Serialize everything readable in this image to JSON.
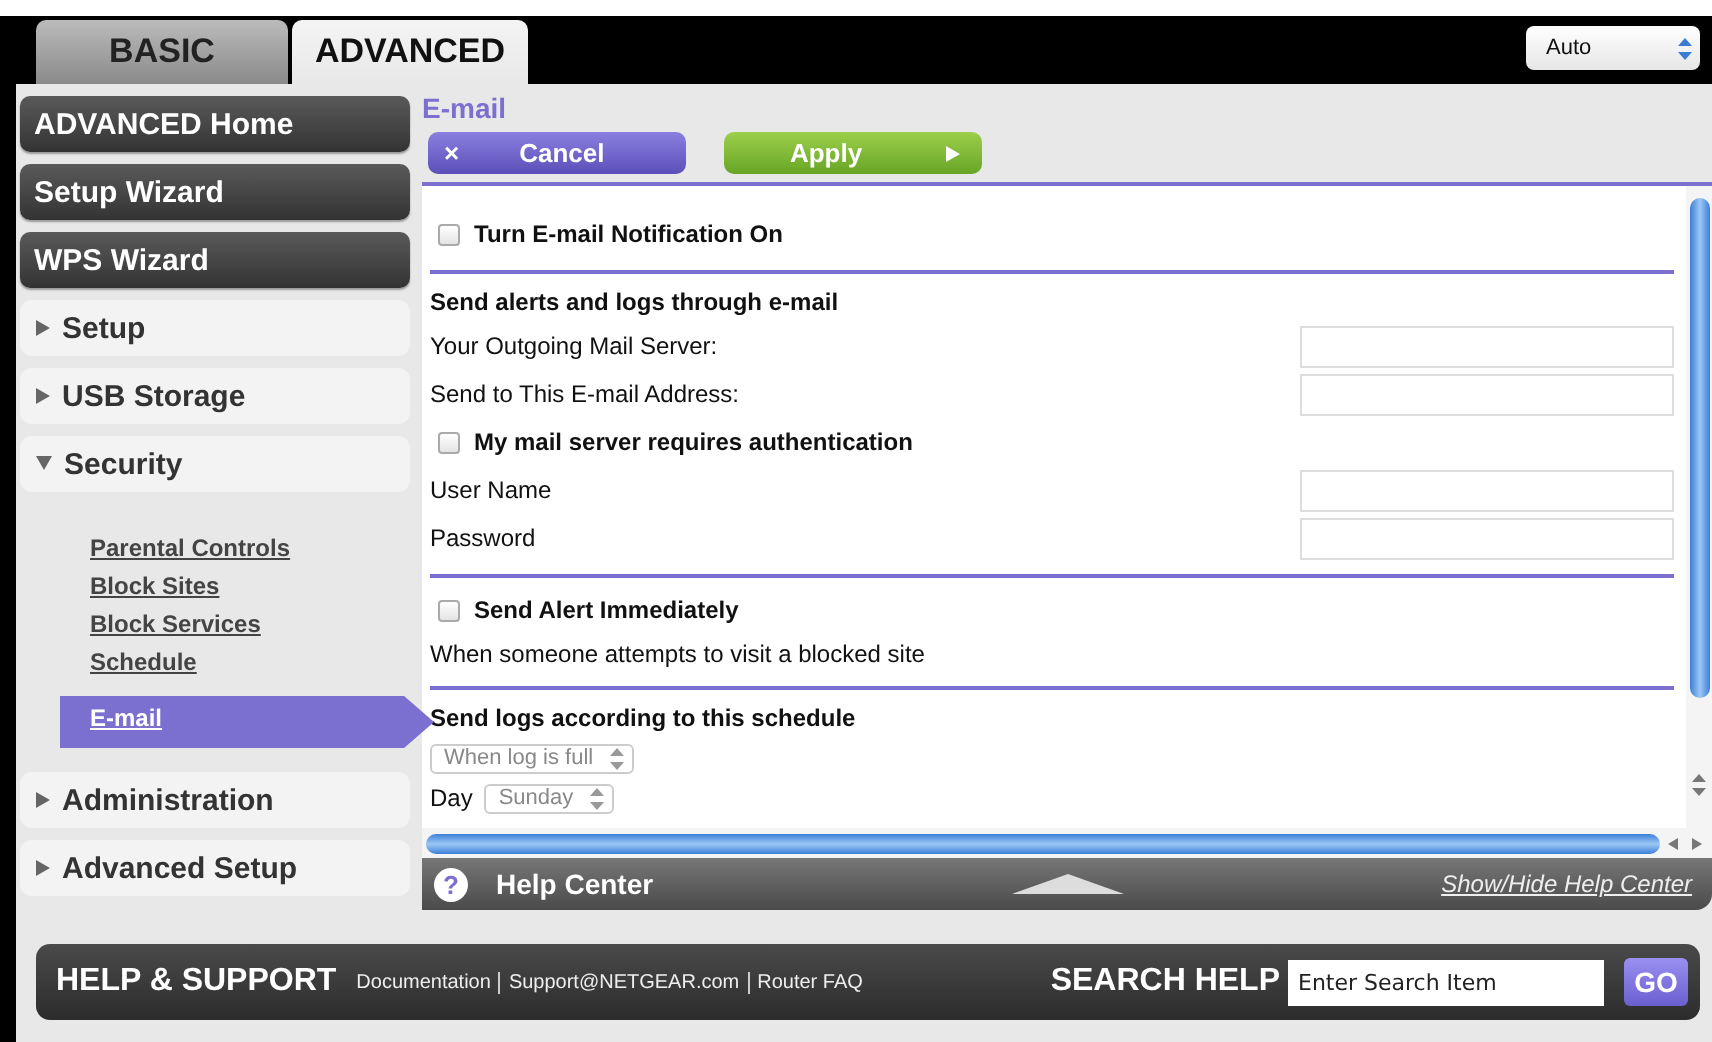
{
  "tabs": [
    {
      "label": "BASIC",
      "selected": false
    },
    {
      "label": "ADVANCED",
      "selected": true
    }
  ],
  "language_select": {
    "value": "Auto"
  },
  "sidebar": {
    "items": [
      {
        "kind": "dark",
        "label": "ADVANCED Home"
      },
      {
        "kind": "dark",
        "label": "Setup Wizard"
      },
      {
        "kind": "dark",
        "label": "WPS Wizard"
      },
      {
        "kind": "section",
        "label": "Setup",
        "expanded": false
      },
      {
        "kind": "section",
        "label": "USB Storage",
        "expanded": false
      },
      {
        "kind": "section",
        "label": "Security",
        "expanded": true,
        "children": [
          {
            "label": "Parental Controls",
            "selected": false
          },
          {
            "label": "Block Sites",
            "selected": false
          },
          {
            "label": "Block Services",
            "selected": false
          },
          {
            "label": "Schedule",
            "selected": false
          },
          {
            "label": "E-mail",
            "selected": true
          }
        ]
      },
      {
        "kind": "section",
        "label": "Administration",
        "expanded": false
      },
      {
        "kind": "section",
        "label": "Advanced Setup",
        "expanded": false
      }
    ]
  },
  "page": {
    "title": "E-mail",
    "buttons": [
      {
        "kind": "cancel",
        "label": "Cancel",
        "icon": "×"
      },
      {
        "kind": "apply",
        "label": "Apply"
      }
    ],
    "sections": [
      [
        {
          "kind": "checkbox",
          "label": "Turn E-mail Notification On",
          "checked": false
        }
      ],
      [
        {
          "kind": "heading",
          "label": "Send alerts and logs through e-mail"
        },
        {
          "kind": "field",
          "label": "Your Outgoing Mail Server:"
        },
        {
          "kind": "field",
          "label": "Send to This E-mail Address:"
        },
        {
          "kind": "checkbox",
          "label": "My mail server requires authentication",
          "checked": false
        },
        {
          "kind": "field",
          "label": "User Name"
        },
        {
          "kind": "field",
          "label": "Password"
        }
      ],
      [
        {
          "kind": "checkbox",
          "label": "Send Alert Immediately",
          "checked": false
        },
        {
          "kind": "note",
          "label": "When someone attempts to visit a blocked site"
        }
      ],
      [
        {
          "kind": "heading",
          "label": "Send logs according to this schedule"
        },
        {
          "kind": "select",
          "value": "When log is full"
        },
        {
          "kind": "select",
          "label": "Day",
          "value": "Sunday"
        }
      ]
    ]
  },
  "help_bar": {
    "icon": "?",
    "title": "Help Center",
    "toggle_link": "Show/Hide Help Center"
  },
  "footer": {
    "title": "HELP & SUPPORT",
    "links": [
      "Documentation",
      "Support@NETGEAR.com",
      "Router FAQ"
    ],
    "search_label": "SEARCH HELP",
    "search_placeholder": "Enter Search Item",
    "go": "GO"
  }
}
